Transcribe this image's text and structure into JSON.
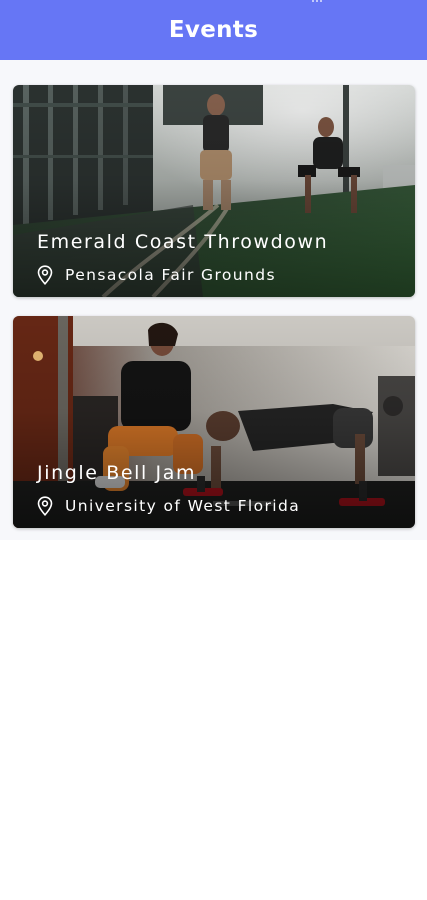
{
  "header": {
    "title": "Events",
    "background_color": "#6676f5"
  },
  "events": [
    {
      "name": "Emerald Coast Throwdown",
      "location": "Pensacola Fair Grounds",
      "icon": "map-pin-icon",
      "image": "gym-battle-ropes-photo"
    },
    {
      "name": "Jingle Bell Jam",
      "location": "University of West Florida",
      "icon": "map-pin-icon",
      "image": "trainer-pushup-photo"
    }
  ]
}
